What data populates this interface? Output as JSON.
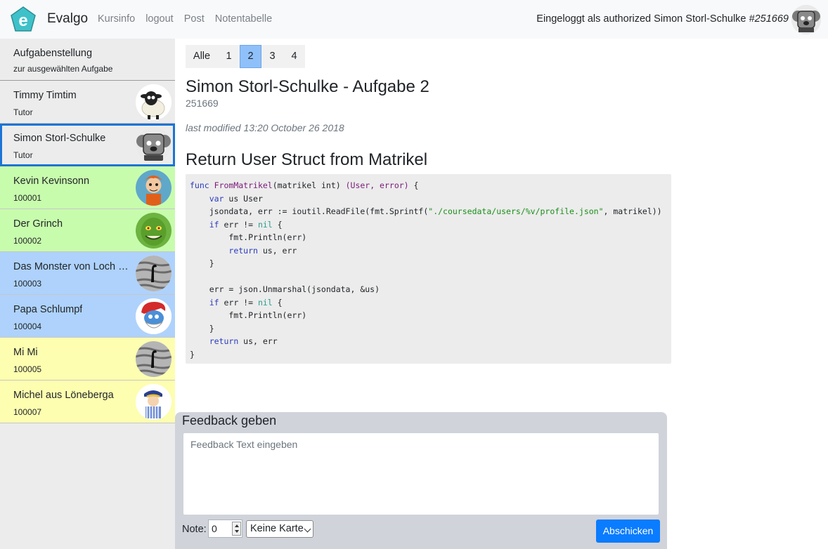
{
  "navbar": {
    "brand": "Evalgo",
    "links": [
      "Kursinfo",
      "logout",
      "Post",
      "Notentabelle"
    ],
    "login_prefix": "Eingeloggt als authorized Simon Storl-Schulke",
    "login_id": "#251669"
  },
  "sidebar": {
    "header": {
      "title": "Aufgabenstellung",
      "subtitle": "zur ausgewählten Aufgabe"
    },
    "items": [
      {
        "name": "Timmy Timtim",
        "sub": "Tutor",
        "bg": "#ececec",
        "avatar": "sheep-avatar"
      },
      {
        "name": "Simon Storl-Schulke",
        "sub": "Tutor",
        "bg": "#ececec",
        "avatar": "koala-avatar",
        "selected": true
      },
      {
        "name": "Kevin Kevinsonn",
        "sub": "100001",
        "bg": "#c8fcad",
        "avatar": "cartoon-boy-avatar"
      },
      {
        "name": "Der Grinch",
        "sub": "100002",
        "bg": "#c8fcad",
        "avatar": "grinch-avatar"
      },
      {
        "name": "Das Monster von Loch N...",
        "sub": "100003",
        "bg": "#aed2fb",
        "avatar": "loch-ness-avatar"
      },
      {
        "name": "Papa Schlumpf",
        "sub": "100004",
        "bg": "#aed2fb",
        "avatar": "smurf-avatar"
      },
      {
        "name": "Mi Mi",
        "sub": "100005",
        "bg": "#fdfeb0",
        "avatar": "loch-ness-avatar"
      },
      {
        "name": "Michel aus Löneberga",
        "sub": "100007",
        "bg": "#fdfeb0",
        "avatar": "michel-avatar"
      }
    ]
  },
  "pager": {
    "pages": [
      "Alle",
      "1",
      "2",
      "3",
      "4"
    ],
    "active": "2"
  },
  "main": {
    "title": "Simon Storl-Schulke - Aufgabe 2",
    "student_id": "251669",
    "modified": "last modified 13:20 October 26 2018",
    "task_title": "Return User Struct from Matrikel"
  },
  "code": {
    "lines": [
      "func FromMatrikel(matrikel int) (User, error) {",
      "    var us User",
      "    jsondata, err := ioutil.ReadFile(fmt.Sprintf(\"./coursedata/users/%v/profile.json\", matrikel))",
      "    if err != nil {",
      "        fmt.Println(err)",
      "        return us, err",
      "    }",
      "",
      "    err = json.Unmarshal(jsondata, &us)",
      "    if err != nil {",
      "        fmt.Println(err)",
      "    }",
      "    return us, err",
      "}"
    ]
  },
  "feedback": {
    "title": "Feedback geben",
    "placeholder": "Feedback Text eingeben",
    "note_label": "Note:",
    "note_value": "0",
    "card_value": "Keine Karte",
    "submit_label": "Abschicken"
  },
  "colors": {
    "accent": "#0a7cff",
    "green": "#c8fcad",
    "blue": "#aed2fb",
    "yellow": "#fdfeb0"
  }
}
